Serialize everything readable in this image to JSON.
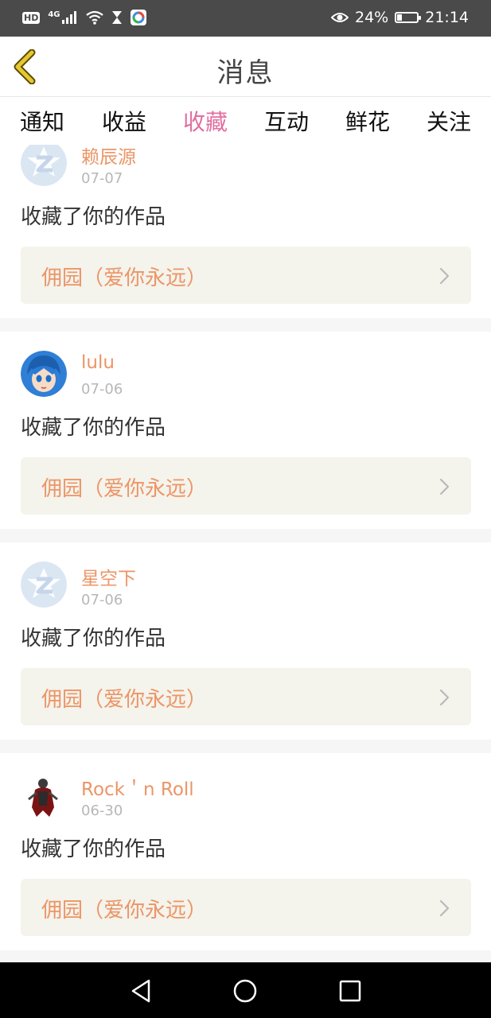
{
  "status": {
    "hd": "HD",
    "network": "4G",
    "battery_percent_label": "24%",
    "battery_level": 0.24,
    "time": "21:14",
    "icons": [
      "signal-icon",
      "wifi-icon",
      "hourglass-icon",
      "app-notification-icon",
      "eye-icon",
      "battery-icon"
    ]
  },
  "header": {
    "title": "消息"
  },
  "tabs": [
    {
      "label": "通知"
    },
    {
      "label": "收益"
    },
    {
      "label": "收藏"
    },
    {
      "label": "互动"
    },
    {
      "label": "鲜花"
    },
    {
      "label": "关注"
    }
  ],
  "active_tab": "收藏",
  "colors": {
    "accent_pink": "#e26ea1",
    "name_orange": "#ec9566",
    "work_bg": "#f4f3ec"
  },
  "items": [
    {
      "name": "赖辰源",
      "date": "07-07",
      "action": "收藏了你的作品",
      "work": "佣园（爱你永远）",
      "avatar": "default-avatar"
    },
    {
      "name": "lulu",
      "date": "07-06",
      "action": "收藏了你的作品",
      "work": "佣园（爱你永远）",
      "avatar": "anime-avatar"
    },
    {
      "name": "星空下",
      "date": "07-06",
      "action": "收藏了你的作品",
      "work": "佣园（爱你永远）",
      "avatar": "default-avatar"
    },
    {
      "name": "Rock＇n Roll",
      "date": "06-30",
      "action": "收藏了你的作品",
      "work": "佣园（爱你永远）",
      "avatar": "figure-avatar"
    }
  ],
  "navbar": {
    "icons": [
      "back-triangle-icon",
      "home-circle-icon",
      "recents-square-icon"
    ]
  }
}
